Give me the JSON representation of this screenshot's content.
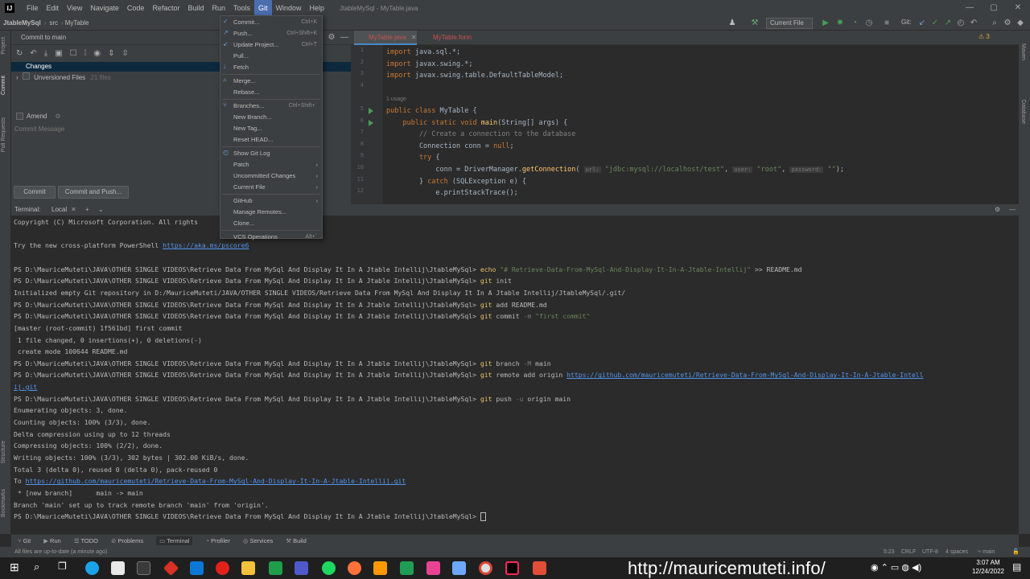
{
  "menubar": {
    "logo": "IJ",
    "items": [
      "File",
      "Edit",
      "View",
      "Navigate",
      "Code",
      "Refactor",
      "Build",
      "Run",
      "Tools",
      "Git",
      "Window",
      "Help"
    ],
    "active_item": "Git",
    "window_title": "JtableMySql - MyTable.java"
  },
  "navbar": {
    "project": "JtableMySql",
    "folder": "src",
    "file": "MyTable",
    "run_config": "Current File",
    "git_label": "Git:"
  },
  "left_stripe": [
    "Project",
    "Commit",
    "Pull Requests",
    "Structure",
    "Bookmarks"
  ],
  "right_stripe": [
    "Maven",
    "Database"
  ],
  "commit_panel": {
    "header": "Commit to main",
    "changes_label": "Changes",
    "unversioned_label": "Unversioned Files",
    "unversioned_count": "21 files",
    "amend_label": "Amend",
    "message_placeholder": "Commit Message",
    "commit_button": "Commit",
    "commit_push_button": "Commit and Push..."
  },
  "editor": {
    "tabs": [
      {
        "label": "MyTable.java",
        "active": true
      },
      {
        "label": "MyTable.form",
        "active": false
      }
    ],
    "warning_count": "3",
    "usage_hint": "1 usage",
    "lines": [
      {
        "num": "1",
        "parts": [
          [
            "kw",
            "import "
          ],
          [
            "",
            "java.sql.*;"
          ]
        ]
      },
      {
        "num": "2",
        "parts": [
          [
            "kw",
            "import "
          ],
          [
            "",
            "javax.swing.*;"
          ]
        ]
      },
      {
        "num": "3",
        "parts": [
          [
            "kw",
            "import "
          ],
          [
            "",
            "javax.swing.table.DefaultTableModel;"
          ]
        ]
      },
      {
        "num": "4",
        "parts": []
      },
      {
        "num": "5",
        "parts": [
          [
            "kw",
            "public class "
          ],
          [
            "",
            "MyTable {"
          ]
        ]
      },
      {
        "num": "6",
        "parts": [
          [
            "kw",
            "    public static void "
          ],
          [
            "fn",
            "main"
          ],
          [
            "",
            "(String[] args) {"
          ]
        ]
      },
      {
        "num": "7",
        "parts": [
          [
            "cmt",
            "        // Create a connection to the database"
          ]
        ]
      },
      {
        "num": "8",
        "parts": [
          [
            "",
            "        Connection conn = "
          ],
          [
            "kw",
            "null"
          ],
          [
            "",
            ";"
          ]
        ]
      },
      {
        "num": "9",
        "parts": [
          [
            "kw",
            "        try "
          ],
          [
            "",
            "{"
          ]
        ]
      },
      {
        "num": "10",
        "parts": [
          [
            "",
            "            conn = DriverManager."
          ],
          [
            "fn",
            "getConnection"
          ],
          [
            "",
            "( "
          ],
          [
            "hint",
            "url:"
          ],
          [
            "str",
            " \"jdbc:mysql://localhost/test\""
          ],
          [
            "",
            ", "
          ],
          [
            "hint",
            "user:"
          ],
          [
            "str",
            " \"root\""
          ],
          [
            "",
            ", "
          ],
          [
            "hint",
            "password:"
          ],
          [
            "str",
            " \"\""
          ],
          [
            "",
            ");"
          ]
        ]
      },
      {
        "num": "11",
        "parts": [
          [
            "",
            "        } "
          ],
          [
            "kw",
            "catch "
          ],
          [
            "",
            "(SQLException e) {"
          ]
        ]
      },
      {
        "num": "12",
        "parts": [
          [
            "",
            "            e.printStackTrace();"
          ]
        ]
      }
    ]
  },
  "terminal": {
    "tab_label": "Terminal:",
    "session": "Local",
    "lines": [
      [
        [
          "",
          "Copyright (C) Microsoft Corporation. All rights"
        ]
      ],
      [],
      [
        [
          "",
          "Try the new cross-platform PowerShell "
        ],
        [
          "tlink",
          "https://aka.ms/pscore6"
        ]
      ],
      [],
      [
        [
          "",
          "PS D:\\MauriceMuteti\\JAVA\\OTHER SINGLE VIDEOS\\Retrieve Data From MySql And Display It In A Jtable Intellij\\JtableMySql> "
        ],
        [
          "tcmd",
          "echo "
        ],
        [
          "tstr",
          "\"# Retrieve-Data-From-MySql-And-Display-It-In-A-Jtable-Intellij\""
        ],
        [
          "",
          " >> README.md"
        ]
      ],
      [
        [
          "",
          "PS D:\\MauriceMuteti\\JAVA\\OTHER SINGLE VIDEOS\\Retrieve Data From MySql And Display It In A Jtable Intellij\\JtableMySql> "
        ],
        [
          "tcmd",
          "git "
        ],
        [
          "",
          "init"
        ]
      ],
      [
        [
          "",
          "Initialized empty Git repository in D:/MauriceMuteti/JAVA/OTHER SINGLE VIDEOS/Retrieve Data From MySql And Display It In A Jtable Intellij/JtableMySql/.git/"
        ]
      ],
      [
        [
          "",
          "PS D:\\MauriceMuteti\\JAVA\\OTHER SINGLE VIDEOS\\Retrieve Data From MySql And Display It In A Jtable Intellij\\JtableMySql> "
        ],
        [
          "tcmd",
          "git "
        ],
        [
          "",
          "add README.md"
        ]
      ],
      [
        [
          "",
          "PS D:\\MauriceMuteti\\JAVA\\OTHER SINGLE VIDEOS\\Retrieve Data From MySql And Display It In A Jtable Intellij\\JtableMySql> "
        ],
        [
          "tcmd",
          "git "
        ],
        [
          "",
          "commit "
        ],
        [
          "tflag",
          "-m "
        ],
        [
          "tstr",
          "\"first commit\""
        ]
      ],
      [
        [
          "",
          "[master (root-commit) 1f561bd] first commit"
        ]
      ],
      [
        [
          "",
          " 1 file changed, 0 insertions(+), 0 deletions(-)"
        ]
      ],
      [
        [
          "",
          " create mode 100644 README.md"
        ]
      ],
      [
        [
          "",
          "PS D:\\MauriceMuteti\\JAVA\\OTHER SINGLE VIDEOS\\Retrieve Data From MySql And Display It In A Jtable Intellij\\JtableMySql> "
        ],
        [
          "tcmd",
          "git "
        ],
        [
          "",
          "branch "
        ],
        [
          "tflag",
          "-M "
        ],
        [
          "",
          "main"
        ]
      ],
      [
        [
          "",
          "PS D:\\MauriceMuteti\\JAVA\\OTHER SINGLE VIDEOS\\Retrieve Data From MySql And Display It In A Jtable Intellij\\JtableMySql> "
        ],
        [
          "tcmd",
          "git "
        ],
        [
          "",
          "remote add origin "
        ],
        [
          "tlink",
          "https://github.com/mauricemuteti/Retrieve-Data-From-MySql-And-Display-It-In-A-Jtable-Intell"
        ]
      ],
      [
        [
          "tlink",
          "ij.git"
        ]
      ],
      [
        [
          "",
          "PS D:\\MauriceMuteti\\JAVA\\OTHER SINGLE VIDEOS\\Retrieve Data From MySql And Display It In A Jtable Intellij\\JtableMySql> "
        ],
        [
          "tcmd",
          "git "
        ],
        [
          "",
          "push "
        ],
        [
          "tflag",
          "-u "
        ],
        [
          "",
          "origin main"
        ]
      ],
      [
        [
          "",
          "Enumerating objects: 3, done."
        ]
      ],
      [
        [
          "",
          "Counting objects: 100% (3/3), done."
        ]
      ],
      [
        [
          "",
          "Delta compression using up to 12 threads"
        ]
      ],
      [
        [
          "",
          "Compressing objects: 100% (2/2), done."
        ]
      ],
      [
        [
          "",
          "Writing objects: 100% (3/3), 302 bytes | 302.00 KiB/s, done."
        ]
      ],
      [
        [
          "",
          "Total 3 (delta 0), reused 0 (delta 0), pack-reused 0"
        ]
      ],
      [
        [
          "",
          "To "
        ],
        [
          "tlink",
          "https://github.com/mauricemuteti/Retrieve-Data-From-MySql-And-Display-It-In-A-Jtable-Intellij.git"
        ]
      ],
      [
        [
          "",
          " * [new branch]      main -> main"
        ]
      ],
      [
        [
          "",
          "Branch 'main' set up to track remote branch 'main' from 'origin'."
        ]
      ],
      [
        [
          "",
          "PS D:\\MauriceMuteti\\JAVA\\OTHER SINGLE VIDEOS\\Retrieve Data From MySql And Display It In A Jtable Intellij\\JtableMySql> "
        ]
      ]
    ]
  },
  "git_menu": {
    "items": [
      {
        "label": "Commit...",
        "shortcut": "Ctrl+K",
        "icon": "commit-icon"
      },
      {
        "label": "Push...",
        "shortcut": "Ctrl+Shift+K",
        "icon": "push-icon"
      },
      {
        "label": "Update Project...",
        "shortcut": "Ctrl+T",
        "icon": "update-icon"
      },
      {
        "label": "Pull...",
        "shortcut": ""
      },
      {
        "label": "Fetch",
        "shortcut": "",
        "icon": "fetch-icon"
      },
      {
        "sep": true
      },
      {
        "label": "Merge...",
        "shortcut": "",
        "icon": "merge-icon"
      },
      {
        "label": "Rebase...",
        "shortcut": ""
      },
      {
        "sep": true
      },
      {
        "label": "Branches...",
        "shortcut": "Ctrl+Shift+`",
        "icon": "branch-icon"
      },
      {
        "label": "New Branch...",
        "shortcut": ""
      },
      {
        "label": "New Tag...",
        "shortcut": ""
      },
      {
        "label": "Reset HEAD...",
        "shortcut": ""
      },
      {
        "sep": true
      },
      {
        "label": "Show Git Log",
        "shortcut": "",
        "icon": "history-icon"
      },
      {
        "label": "Patch",
        "submenu": true
      },
      {
        "label": "Uncommitted Changes",
        "submenu": true
      },
      {
        "label": "Current File",
        "submenu": true
      },
      {
        "sep": true
      },
      {
        "label": "GitHub",
        "submenu": true
      },
      {
        "label": "Manage Remotes...",
        "shortcut": ""
      },
      {
        "label": "Clone...",
        "shortcut": ""
      },
      {
        "sep": true
      },
      {
        "label": "VCS Operations",
        "shortcut": "Alt+`"
      }
    ]
  },
  "tool_bar": [
    "Git",
    "Run",
    "TODO",
    "Problems",
    "Terminal",
    "Profiler",
    "Services",
    "Build"
  ],
  "tool_bar_active": "Terminal",
  "status_bar": {
    "message": "All files are up-to-date (a minute ago)",
    "position": "5:23",
    "line_sep": "CRLF",
    "encoding": "UTF-8",
    "indent": "4 spaces",
    "branch": "main"
  },
  "taskbar": {
    "watermark": "http://mauricemuteti.info/",
    "time": "3:07 AM",
    "date": "12/24/2022"
  },
  "colors": {
    "menu_bg": "#3c3f41",
    "editor_bg": "#2b2b2b",
    "selection": "#4b6eaf",
    "error_tab": "#c75450"
  }
}
